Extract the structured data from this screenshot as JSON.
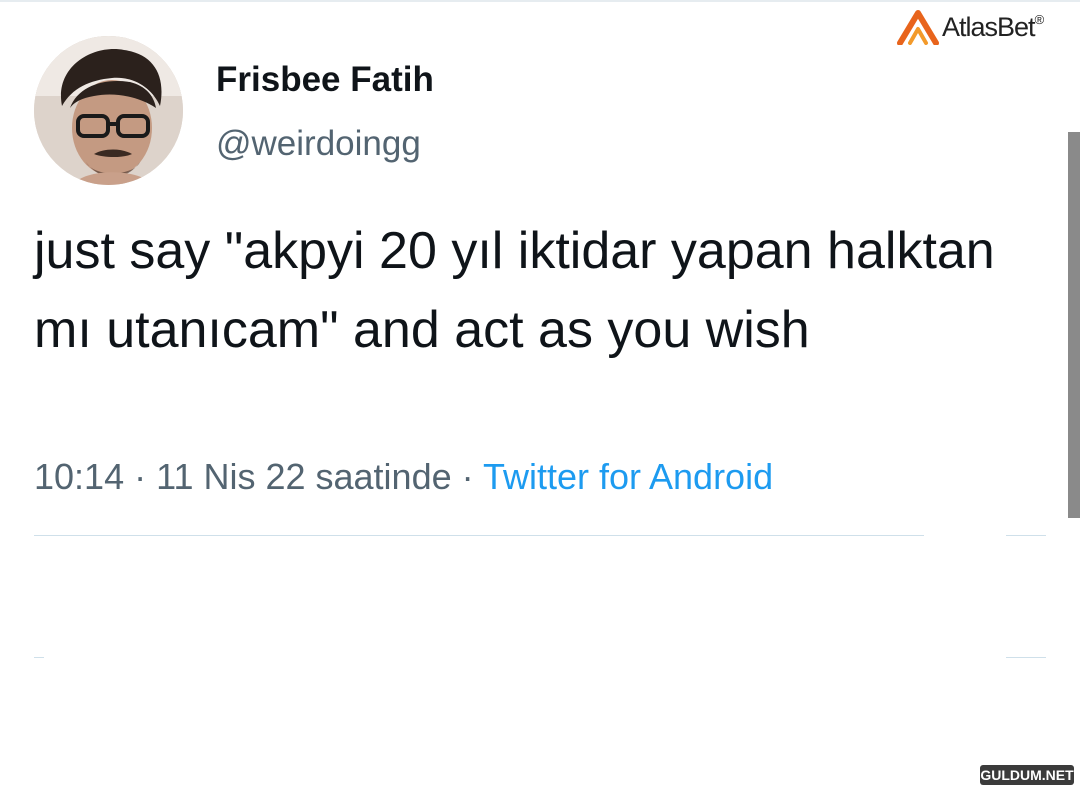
{
  "author": {
    "display_name": "Frisbee Fatih",
    "handle": "@weirdoingg"
  },
  "tweet": {
    "text": "just say \"akpyi 20 yıl iktidar yapan halktan mı utanıcam\" and act as you wish",
    "time": "10:14",
    "date": "11 Nis 22 saatinde",
    "separator": " · ",
    "source": "Twitter for Android"
  },
  "brand": {
    "name": "AtlasBet",
    "registered_mark": "®"
  },
  "watermark": {
    "text": "GULDUM.NET"
  },
  "colors": {
    "text_primary": "#0f1419",
    "text_secondary": "#536471",
    "link": "#1d9bf0",
    "brand_orange": "#e8641c"
  }
}
